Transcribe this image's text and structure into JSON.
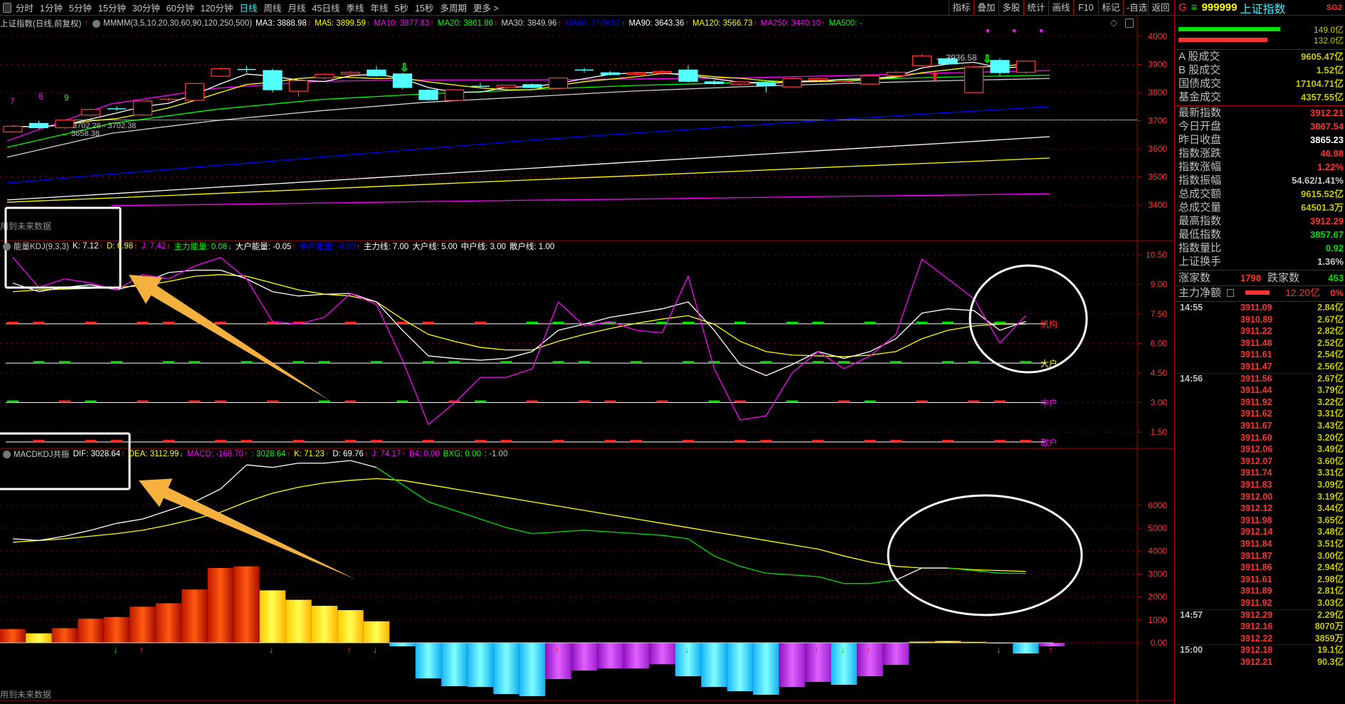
{
  "toolbar": {
    "periods": [
      "分时",
      "1分钟",
      "5分钟",
      "15分钟",
      "30分钟",
      "60分钟",
      "120分钟",
      "日线",
      "周线",
      "月线",
      "45日线",
      "季线",
      "年线",
      "5秒",
      "15秒",
      "多周期",
      "更多 >"
    ],
    "active_period": "日线",
    "right_buttons": [
      "指标",
      "叠加",
      "多股",
      "统计",
      "画线",
      "F10",
      "标记",
      "-自选",
      "返回"
    ]
  },
  "main": {
    "title": "上证指数(日线,前复权)",
    "indicator": "MMMM(3,5,10,20,30,60,90,120,250,500)",
    "legend": [
      {
        "label": "MA3: 3888.98",
        "color": "#ffffff",
        "arrow": "↑"
      },
      {
        "label": "MA5: 3899.59",
        "color": "#ffff00",
        "arrow": "↑"
      },
      {
        "label": "MA10: 3877.83",
        "color": "#ff00ff",
        "arrow": "↑"
      },
      {
        "label": "MA20: 3861.86",
        "color": "#00ff00",
        "arrow": "↑"
      },
      {
        "label": "MA30: 3849.96",
        "color": "#d0d0d0",
        "arrow": "↑"
      },
      {
        "label": "MA60: 3749.57",
        "color": "#0000ff",
        "arrow": "↑"
      },
      {
        "label": "MA90: 3643.36",
        "color": "#ffffff",
        "arrow": "↑"
      },
      {
        "label": "MA120: 3566.73",
        "color": "#ffff00",
        "arrow": "↑"
      },
      {
        "label": "MA250: 3440.10",
        "color": "#ff00ff",
        "arrow": "↑"
      },
      {
        "label": "MA500: -",
        "color": "#00ff00",
        "arrow": ""
      }
    ],
    "price_axis": [
      "4000",
      "3900",
      "3800",
      "3700",
      "3600",
      "3500",
      "3400"
    ],
    "candles": [
      [
        3660,
        3685,
        3655,
        3680
      ],
      [
        3690,
        3700,
        3670,
        3675
      ],
      [
        3675,
        3705,
        3670,
        3702
      ],
      [
        3720,
        3745,
        3715,
        3740
      ],
      [
        3742,
        3752,
        3735,
        3740
      ],
      [
        3720,
        3772,
        3718,
        3770
      ],
      [
        3775,
        3782,
        3768,
        3776
      ],
      [
        3772,
        3835,
        3770,
        3832
      ],
      [
        3858,
        3890,
        3855,
        3885
      ],
      [
        3882,
        3895,
        3870,
        3880
      ],
      [
        3878,
        3885,
        3800,
        3810
      ],
      [
        3805,
        3845,
        3785,
        3842
      ],
      [
        3852,
        3868,
        3845,
        3865
      ],
      [
        3866,
        3876,
        3860,
        3872
      ],
      [
        3880,
        3895,
        3855,
        3860
      ],
      [
        3866,
        3870,
        3812,
        3818
      ],
      [
        3808,
        3812,
        3770,
        3775
      ],
      [
        3772,
        3812,
        3770,
        3810
      ],
      [
        3822,
        3835,
        3815,
        3820
      ],
      [
        3818,
        3828,
        3812,
        3826
      ],
      [
        3828,
        3832,
        3815,
        3818
      ],
      [
        3815,
        3855,
        3812,
        3852
      ],
      [
        3880,
        3888,
        3870,
        3878
      ],
      [
        3870,
        3876,
        3860,
        3864
      ],
      [
        3865,
        3874,
        3855,
        3870
      ],
      [
        3870,
        3880,
        3862,
        3875
      ],
      [
        3880,
        3898,
        3835,
        3840
      ],
      [
        3838,
        3845,
        3828,
        3832
      ],
      [
        3830,
        3842,
        3820,
        3838
      ],
      [
        3835,
        3838,
        3800,
        3825
      ],
      [
        3820,
        3855,
        3818,
        3850
      ],
      [
        3845,
        3855,
        3840,
        3850
      ],
      [
        3838,
        3845,
        3830,
        3840
      ],
      [
        3830,
        3865,
        3828,
        3860
      ],
      [
        3860,
        3878,
        3855,
        3872
      ],
      [
        3896,
        3937,
        3890,
        3930
      ],
      [
        3920,
        3925,
        3898,
        3902
      ],
      [
        3800,
        3895,
        3798,
        3891
      ],
      [
        3914,
        3922,
        3858,
        3871
      ],
      [
        3872,
        3914,
        3866,
        3912
      ]
    ],
    "ma_lines": [
      {
        "name": "MA10",
        "color": "#ff00ff",
        "knots": [
          3628,
          3760,
          3815,
          3840,
          3845,
          3845,
          3848,
          3852,
          3860,
          3870,
          3878
        ]
      },
      {
        "name": "MA20",
        "color": "#00ff00",
        "knots": [
          3605,
          3690,
          3740,
          3775,
          3795,
          3810,
          3825,
          3835,
          3845,
          3855,
          3862
        ]
      },
      {
        "name": "MA30",
        "color": "#d0d0d0",
        "knots": [
          3570,
          3655,
          3700,
          3735,
          3765,
          3785,
          3805,
          3820,
          3832,
          3842,
          3850
        ]
      },
      {
        "name": "MA60",
        "color": "#0000ff",
        "knots": [
          3478,
          3510,
          3540,
          3570,
          3600,
          3630,
          3655,
          3680,
          3705,
          3728,
          3750
        ]
      },
      {
        "name": "MA90",
        "color": "#ffffff",
        "knots": [
          3418,
          3440,
          3463,
          3485,
          3508,
          3530,
          3553,
          3575,
          3598,
          3620,
          3643
        ]
      },
      {
        "name": "MA120",
        "color": "#ffff00",
        "knots": [
          3410,
          3425,
          3441,
          3457,
          3473,
          3489,
          3504,
          3520,
          3536,
          3551,
          3567
        ]
      },
      {
        "name": "MA250",
        "color": "#ff00ff",
        "knots": [
          null,
          3398,
          3402,
          3407,
          3412,
          3417,
          3421,
          3426,
          3431,
          3435,
          3440
        ]
      }
    ],
    "reference_price": 3702.38,
    "annotations": {
      "count_labels": [
        {
          "text": "7",
          "color": "#ff00ff"
        },
        {
          "text": "8",
          "color": "#ff00ff"
        },
        {
          "text": "9",
          "color": "#00ff00"
        }
      ],
      "range_label": "3702.26 - 3702.38",
      "low_label": "← 3658.38",
      "high_label": "← 3936.58",
      "future_data_note": "用到未来数据"
    }
  },
  "kdj": {
    "name": "能量KDJ(9,3,3)",
    "legend": [
      {
        "label": "K: 7.12",
        "color": "#ffffff",
        "arrow": "↑"
      },
      {
        "label": "D: 6.98",
        "color": "#ffff00",
        "arrow": "↑"
      },
      {
        "label": "J: 7.42",
        "color": "#ff00ff",
        "arrow": "↑"
      },
      {
        "label": "主力能量: 0.08",
        "color": "#00ff00",
        "arrow": "↓"
      },
      {
        "label": "大户能量: -0.05",
        "color": "#ffffff",
        "arrow": "↑"
      },
      {
        "label": "中户能量: -0.03",
        "color": "#0000ff",
        "arrow": "↑"
      },
      {
        "label": "主力线: 7.00",
        "color": "#ffffff",
        "arrow": ""
      },
      {
        "label": "大户线: 5.00",
        "color": "#ffffff",
        "arrow": ""
      },
      {
        "label": "中户线: 3.00",
        "color": "#ffffff",
        "arrow": ""
      },
      {
        "label": "散户线: 1.00",
        "color": "#ffffff",
        "arrow": ""
      }
    ],
    "axis": [
      "10.50",
      "9.00",
      "7.50",
      "6.00",
      "4.50",
      "3.00",
      "1.50"
    ],
    "K": [
      9.07,
      8.63,
      8.85,
      8.98,
      8.72,
      9.07,
      9.6,
      9.72,
      9.72,
      9.28,
      8.63,
      8.41,
      8.5,
      8.54,
      8.11,
      6.67,
      5.37,
      5.24,
      5.15,
      5.24,
      5.59,
      6.67,
      6.98,
      7.33,
      7.54,
      7.76,
      8.11,
      6.67,
      4.93,
      4.37,
      4.93,
      5.59,
      5.24,
      5.59,
      6.24,
      7.54,
      7.76,
      7.67,
      6.67,
      7.12
    ],
    "D": [
      8.63,
      8.72,
      8.76,
      8.8,
      8.85,
      8.93,
      9.15,
      9.41,
      9.5,
      9.41,
      9.07,
      8.72,
      8.5,
      8.41,
      8.11,
      7.24,
      6.46,
      6.11,
      5.8,
      5.67,
      5.67,
      6.11,
      6.46,
      6.76,
      7.02,
      7.24,
      7.41,
      6.98,
      6.11,
      5.59,
      5.41,
      5.37,
      5.33,
      5.41,
      5.59,
      6.24,
      6.67,
      6.89,
      6.98,
      6.98
    ],
    "J": [
      10.37,
      8.85,
      9.28,
      9.07,
      8.72,
      9.5,
      9.28,
      9.93,
      10.37,
      9.28,
      7.11,
      6.98,
      7.33,
      8.54,
      7.98,
      5.15,
      1.89,
      2.98,
      4.28,
      4.28,
      4.72,
      8.11,
      6.89,
      7.11,
      6.67,
      6.54,
      9.41,
      4.72,
      2.11,
      2.33,
      4.5,
      5.59,
      4.72,
      5.37,
      6.46,
      10.28,
      9.28,
      8.28,
      6.02,
      7.42
    ],
    "levels": [
      {
        "value": 7,
        "label": "机构",
        "color": "#ff3232"
      },
      {
        "value": 5,
        "label": "大户",
        "color": "#ffff00"
      },
      {
        "value": 3,
        "label": "中户",
        "color": "#ff00ff"
      },
      {
        "value": 1,
        "label": "散户",
        "color": "#ff00ff"
      }
    ]
  },
  "macd": {
    "name": "MACDKDJ共振",
    "legend": [
      {
        "label": "DIF: 3028.64",
        "color": "#ffffff",
        "arrow": "↑"
      },
      {
        "label": "DEA: 3112.99",
        "color": "#ffff00",
        "arrow": "↓"
      },
      {
        "label": "MACD: -168.70",
        "color": "#ff00ff",
        "arrow": "↑"
      },
      {
        "label": ": 3028.64",
        "color": "#00ff00",
        "arrow": "↑"
      },
      {
        "label": "K: 71.23",
        "color": "#ffff00",
        "arrow": "↑"
      },
      {
        "label": "D: 69.76",
        "color": "#ffffff",
        "arrow": "↑"
      },
      {
        "label": "J: 74.17",
        "color": "#ff00ff",
        "arrow": "↑"
      },
      {
        "label": "B4: 0.00",
        "color": "#ff00ff",
        "arrow": ""
      },
      {
        "label": "BXG: 0.00",
        "color": "#00ff00",
        "arrow": ""
      },
      {
        "label": ": -1.00",
        "color": "#c0c0c0",
        "arrow": ""
      }
    ],
    "axis": [
      "6000",
      "5000",
      "4000",
      "3000",
      "2000",
      "1000",
      "0.00"
    ],
    "DIF": [
      4537,
      4462,
      4650,
      4912,
      5212,
      5400,
      5775,
      6150,
      6712,
      7762,
      7650,
      7837,
      7837,
      7950,
      7650,
      6900,
      6150,
      5775,
      5400,
      5025,
      4762,
      4837,
      4912,
      4837,
      4762,
      4687,
      4537,
      3787,
      3337,
      3037,
      2962,
      2887,
      2587,
      2587,
      2737,
      3262,
      3262,
      3150,
      3037,
      3029
    ],
    "DEA": [
      4387,
      4462,
      4537,
      4650,
      4762,
      4912,
      5137,
      5400,
      5700,
      6150,
      6525,
      6787,
      6975,
      7087,
      7162,
      7087,
      6900,
      6712,
      6525,
      6337,
      6150,
      5962,
      5775,
      5587,
      5400,
      5212,
      5025,
      4837,
      4650,
      4462,
      4275,
      4087,
      3787,
      3525,
      3337,
      3262,
      3262,
      3187,
      3150,
      3113
    ],
    "hist": [
      [
        600,
        "red"
      ],
      [
        412,
        "yellow"
      ],
      [
        637,
        "red"
      ],
      [
        1050,
        "red"
      ],
      [
        1125,
        "red"
      ],
      [
        1575,
        "red"
      ],
      [
        1725,
        "red"
      ],
      [
        2325,
        "red"
      ],
      [
        3262,
        "red"
      ],
      [
        3337,
        "red"
      ],
      [
        2287,
        "yellow"
      ],
      [
        1875,
        "yellow"
      ],
      [
        1612,
        "yellow"
      ],
      [
        1425,
        "yellow"
      ],
      [
        937,
        "yellow"
      ],
      [
        -155,
        "cyan"
      ],
      [
        -1553,
        "cyan"
      ],
      [
        -1894,
        "cyan"
      ],
      [
        -1925,
        "cyan"
      ],
      [
        -2236,
        "cyan"
      ],
      [
        -2329,
        "cyan"
      ],
      [
        -1584,
        "magenta"
      ],
      [
        -1211,
        "magenta"
      ],
      [
        -1118,
        "magenta"
      ],
      [
        -1118,
        "magenta"
      ],
      [
        -932,
        "magenta"
      ],
      [
        -1460,
        "cyan"
      ],
      [
        -1925,
        "cyan"
      ],
      [
        -2112,
        "cyan"
      ],
      [
        -2267,
        "cyan"
      ],
      [
        -1925,
        "magenta"
      ],
      [
        -1708,
        "magenta"
      ],
      [
        -1832,
        "cyan"
      ],
      [
        -1460,
        "magenta"
      ],
      [
        -963,
        "magenta"
      ],
      [
        50,
        "yellow"
      ],
      [
        80,
        "yellow"
      ],
      [
        40,
        "yellow"
      ],
      [
        -30,
        "cyan"
      ],
      [
        -466,
        "cyan"
      ],
      [
        -155,
        "magenta"
      ]
    ],
    "buy_signals": [
      5,
      13,
      21,
      31,
      33,
      40
    ],
    "sell_signals": [
      4,
      10,
      14,
      26,
      32,
      38
    ],
    "future_data_note": "用到未来数据"
  },
  "right_panel": {
    "header": {
      "market": "G",
      "code": "999999",
      "name": "上证指数",
      "tag": "SG2"
    },
    "flow_bars": [
      {
        "value": "149.0亿",
        "color": "#00e000",
        "fill": 0.95
      },
      {
        "value": "132.0亿",
        "color": "#ff3232",
        "fill": 0.83
      }
    ],
    "turnover": [
      {
        "label": "A 股成交",
        "value": "9605.47亿",
        "color": "#c8c800"
      },
      {
        "label": "B 股成交",
        "value": "1.52亿",
        "color": "#c8c800"
      },
      {
        "label": "国债成交",
        "value": "17104.71亿",
        "color": "#c8c800"
      },
      {
        "label": "基金成交",
        "value": "4357.55亿",
        "color": "#c8c800"
      }
    ],
    "quote": [
      {
        "label": "最新指数",
        "value": "3912.21",
        "color": "#ff3232"
      },
      {
        "label": "今日开盘",
        "value": "3867.54",
        "color": "#ff3232"
      },
      {
        "label": "昨日收盘",
        "value": "3865.23",
        "color": "#ffffff"
      },
      {
        "label": "指数涨跌",
        "value": "46.98",
        "color": "#ff3232"
      },
      {
        "label": "指数涨幅",
        "value": "1.22%",
        "color": "#ff3232"
      },
      {
        "label": "指数振幅",
        "value": "54.62/1.41%",
        "color": "#c8c8c8"
      },
      {
        "label": "总成交额",
        "value": "9615.52亿",
        "color": "#c8c800"
      },
      {
        "label": "总成交量",
        "value": "64501.3万",
        "color": "#c8c800"
      },
      {
        "label": "最高指数",
        "value": "3912.29",
        "color": "#ff3232"
      },
      {
        "label": "最低指数",
        "value": "3857.67",
        "color": "#00e000"
      },
      {
        "label": "指数量比",
        "value": "0.92",
        "color": "#00e000"
      },
      {
        "label": "上证换手",
        "value": "1.36%",
        "color": "#c8c8c8"
      }
    ],
    "breadth": {
      "up_label": "涨家数",
      "up": "1798",
      "down_label": "跌家数",
      "down": "453"
    },
    "main_net": {
      "label": "主力净额",
      "value": "12.20亿",
      "pct": "0%"
    },
    "ticks": [
      {
        "time": "14:55",
        "price": "3911.09",
        "vol": "2.84亿"
      },
      {
        "time": "",
        "price": "3910.89",
        "vol": "2.67亿"
      },
      {
        "time": "",
        "price": "3911.22",
        "vol": "2.82亿"
      },
      {
        "time": "",
        "price": "3911.48",
        "vol": "2.52亿"
      },
      {
        "time": "",
        "price": "3911.61",
        "vol": "2.54亿"
      },
      {
        "time": "",
        "price": "3911.47",
        "vol": "2.56亿"
      },
      {
        "time": "14:56",
        "price": "3911.56",
        "vol": "2.67亿"
      },
      {
        "time": "",
        "price": "3911.44",
        "vol": "3.79亿"
      },
      {
        "time": "",
        "price": "3911.92",
        "vol": "3.22亿"
      },
      {
        "time": "",
        "price": "3911.62",
        "vol": "3.31亿"
      },
      {
        "time": "",
        "price": "3911.67",
        "vol": "3.43亿"
      },
      {
        "time": "",
        "price": "3911.60",
        "vol": "3.20亿"
      },
      {
        "time": "",
        "price": "3912.06",
        "vol": "3.49亿"
      },
      {
        "time": "",
        "price": "3912.07",
        "vol": "3.60亿"
      },
      {
        "time": "",
        "price": "3911.74",
        "vol": "3.31亿"
      },
      {
        "time": "",
        "price": "3911.83",
        "vol": "3.09亿"
      },
      {
        "time": "",
        "price": "3912.00",
        "vol": "3.19亿"
      },
      {
        "time": "",
        "price": "3912.12",
        "vol": "3.44亿"
      },
      {
        "time": "",
        "price": "3911.98",
        "vol": "3.65亿"
      },
      {
        "time": "",
        "price": "3912.14",
        "vol": "3.48亿"
      },
      {
        "time": "",
        "price": "3911.84",
        "vol": "3.51亿"
      },
      {
        "time": "",
        "price": "3911.87",
        "vol": "3.00亿"
      },
      {
        "time": "",
        "price": "3911.86",
        "vol": "2.94亿"
      },
      {
        "time": "",
        "price": "3911.61",
        "vol": "2.98亿"
      },
      {
        "time": "",
        "price": "3911.89",
        "vol": "2.81亿"
      },
      {
        "time": "",
        "price": "3911.92",
        "vol": "3.03亿"
      },
      {
        "time": "14:57",
        "price": "3912.29",
        "vol": "2.29亿"
      },
      {
        "time": "",
        "price": "3912.16",
        "vol": "8070万"
      },
      {
        "time": "",
        "price": "3912.22",
        "vol": "3859万"
      },
      {
        "time": "15:00",
        "price": "3912.18",
        "vol": "19.1亿"
      },
      {
        "time": "",
        "price": "3912.21",
        "vol": "90.3亿"
      }
    ]
  }
}
